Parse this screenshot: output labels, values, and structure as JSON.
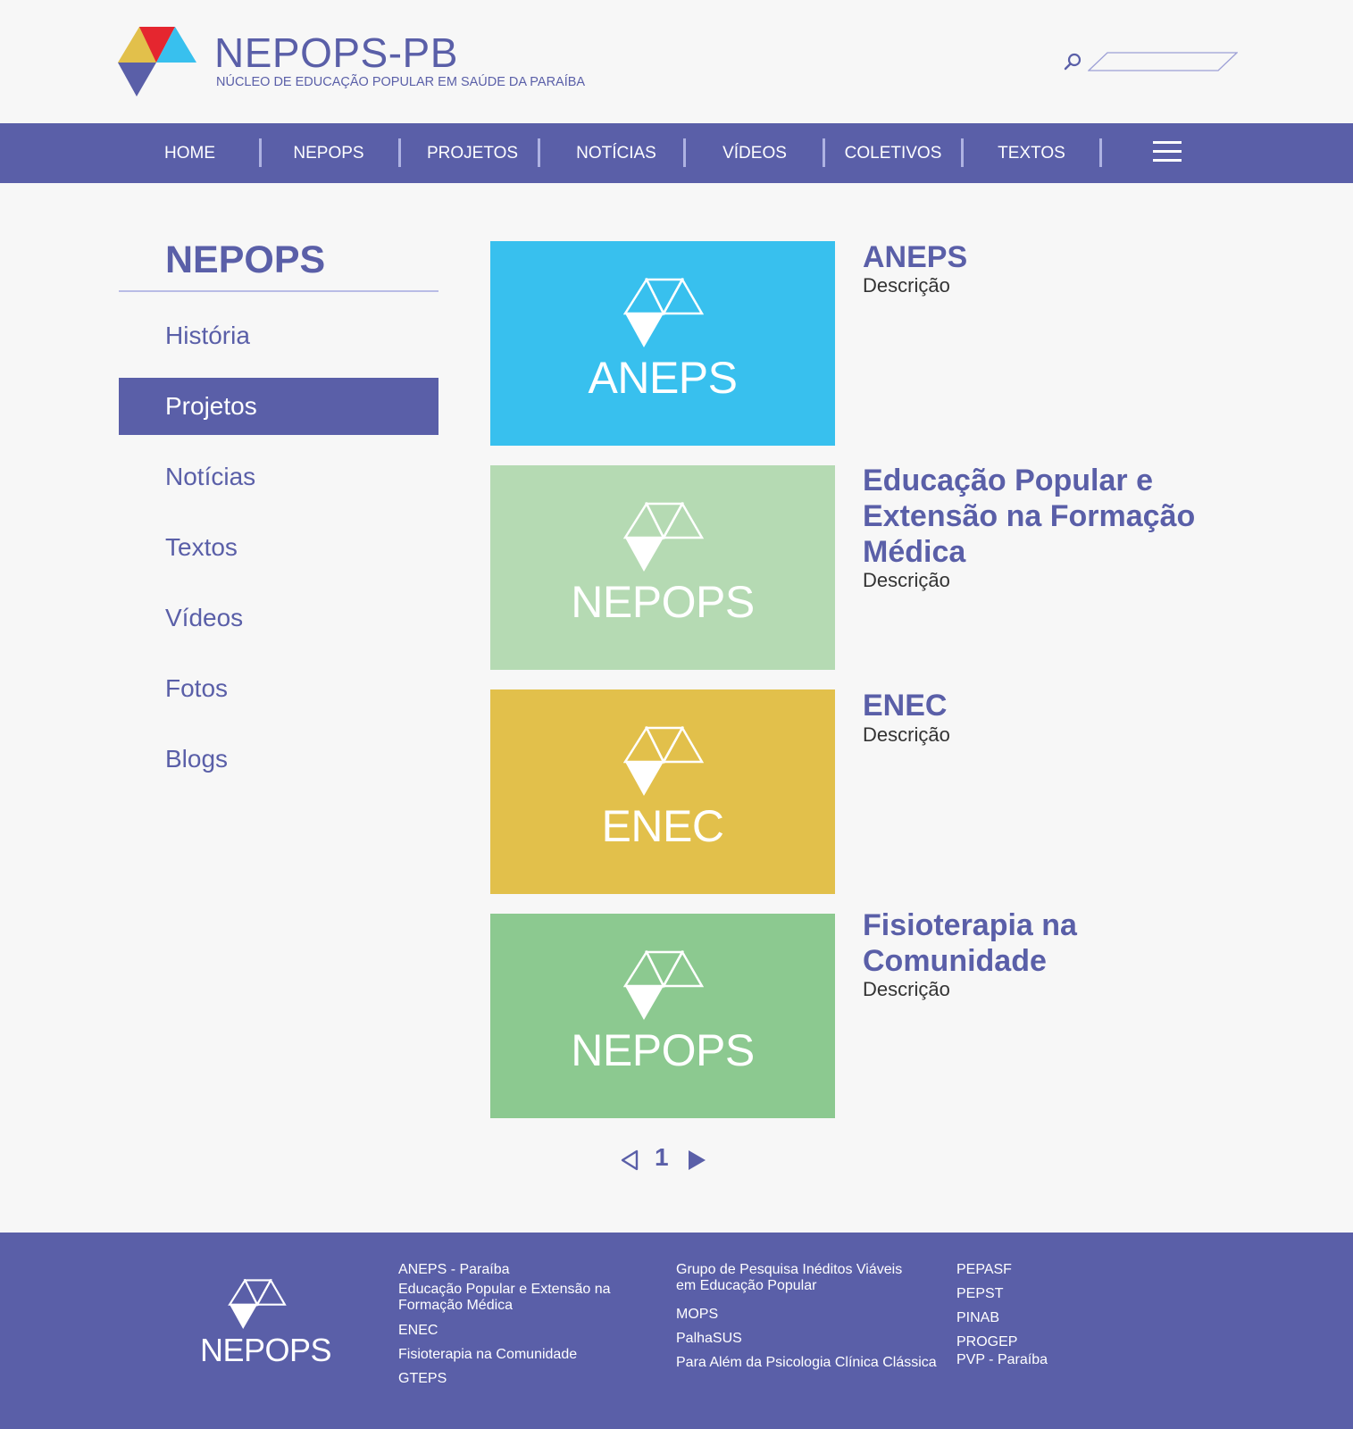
{
  "brand": {
    "title": "NEPOPS-PB",
    "subtitle": "NÚCLEO DE EDUCAÇÃO POPULAR EM SAÚDE DA PARAÍBA",
    "colors": {
      "purple": "#5a5fa8",
      "red": "#e5262f",
      "yellow": "#e2c04b",
      "cyan": "#38c0ee"
    }
  },
  "search": {
    "placeholder": "",
    "icon": "search-icon"
  },
  "nav": {
    "items": [
      "HOME",
      "NEPOPS",
      "PROJETOS",
      "NOTÍCIAS",
      "VÍDEOS",
      "COLETIVOS",
      "TEXTOS"
    ],
    "menu_icon": "hamburger-icon"
  },
  "sidebar": {
    "title": "NEPOPS",
    "items": [
      {
        "label": "História",
        "active": false
      },
      {
        "label": "Projetos",
        "active": true
      },
      {
        "label": "Notícias",
        "active": false
      },
      {
        "label": "Textos",
        "active": false
      },
      {
        "label": "Vídeos",
        "active": false
      },
      {
        "label": "Fotos",
        "active": false
      },
      {
        "label": "Blogs",
        "active": false
      }
    ]
  },
  "projects": [
    {
      "tile_label": "ANEPS",
      "tile_color": "#38c0ee",
      "title": "ANEPS",
      "description": "Descrição"
    },
    {
      "tile_label": "NEPOPS",
      "tile_color": "#b5dab3",
      "title": "Educação Popular e Extensão na Formação Médica",
      "description": "Descrição"
    },
    {
      "tile_label": "ENEC",
      "tile_color": "#e2c04b",
      "title": "ENEC",
      "description": "Descrição"
    },
    {
      "tile_label": "NEPOPS",
      "tile_color": "#8cc990",
      "title": "Fisioterapia na Comunidade",
      "description": "Descrição"
    }
  ],
  "pagination": {
    "current": "1",
    "prev_icon": "triangle-left-outline-icon",
    "next_icon": "triangle-right-icon"
  },
  "footer": {
    "logo_text": "NEPOPS",
    "col1": [
      "ANEPS - Paraíba",
      "Educação Popular e Extensão na Formação Médica",
      "ENEC",
      "Fisioterapia na Comunidade",
      "GTEPS"
    ],
    "col2": [
      "Grupo de Pesquisa Inéditos Viáveis em Educação Popular",
      "MOPS",
      "PalhaSUS",
      "Para Além da Psicologia Clínica Clássica"
    ],
    "col3": [
      "PEPASF",
      "PEPST",
      "PINAB",
      "PROGEP",
      "PVP - Paraíba"
    ]
  }
}
